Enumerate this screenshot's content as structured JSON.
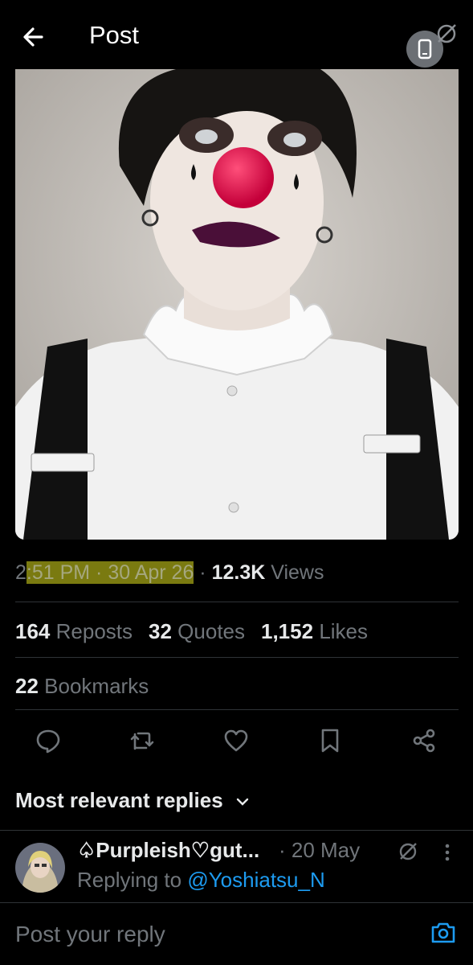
{
  "header": {
    "title": "Post"
  },
  "post": {
    "time_prefix": "2",
    "time_highlight": ":51 PM · 30 Apr 26",
    "separator": " · ",
    "views_count": "12.3K",
    "views_label": "Views",
    "reposts_count": "164",
    "reposts_label": "Reposts",
    "quotes_count": "32",
    "quotes_label": "Quotes",
    "likes_count": "1,152",
    "likes_label": "Likes",
    "bookmarks_count": "22",
    "bookmarks_label": "Bookmarks"
  },
  "actions": [
    "reply-icon",
    "repost-icon",
    "like-icon",
    "bookmark-icon",
    "share-icon"
  ],
  "replies": {
    "heading": "Most relevant replies",
    "items": [
      {
        "name": "♤Purpleish♡gut...",
        "date": "· 20 May",
        "replying_prefix": "Replying to",
        "replying_handle": "@Yoshiatsu_N"
      }
    ]
  },
  "composer": {
    "placeholder": "Post your reply"
  },
  "colors": {
    "background": "#000000",
    "text": "#e7e9ea",
    "muted": "#71767b",
    "accent": "#1d9bf0",
    "highlight": "#7a7a10"
  }
}
